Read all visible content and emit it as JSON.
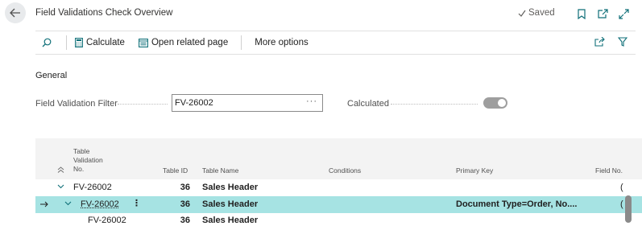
{
  "header": {
    "title": "Field Validations Check Overview",
    "saved_label": "Saved"
  },
  "actions": {
    "calculate": "Calculate",
    "open_related": "Open related page",
    "more_options": "More options"
  },
  "general": {
    "section_title": "General",
    "filter_label": "Field Validation Filter",
    "filter_value": "FV-26002",
    "calculated_label": "Calculated",
    "calculated_on": true
  },
  "grid": {
    "columns": {
      "table_validation_no": [
        "Table",
        "Validation",
        "No."
      ],
      "table_id": "Table ID",
      "table_name": "Table Name",
      "conditions": "Conditions",
      "primary_key": "Primary Key",
      "field_no": "Field No."
    },
    "rows": [
      {
        "no": "FV-26002",
        "table_id": "36",
        "table_name": "Sales Header",
        "primary_key": "",
        "field_no": "("
      },
      {
        "no": "FV-26002",
        "table_id": "36",
        "table_name": "Sales Header",
        "primary_key": "Document Type=Order, No....",
        "field_no": "("
      },
      {
        "no": "FV-26002",
        "table_id": "36",
        "table_name": "Sales Header",
        "primary_key": "",
        "field_no": ""
      }
    ]
  },
  "colors": {
    "selected_row": "#a6e3e3",
    "accent": "#0f6f78",
    "toggle": "#9e9e9e"
  }
}
